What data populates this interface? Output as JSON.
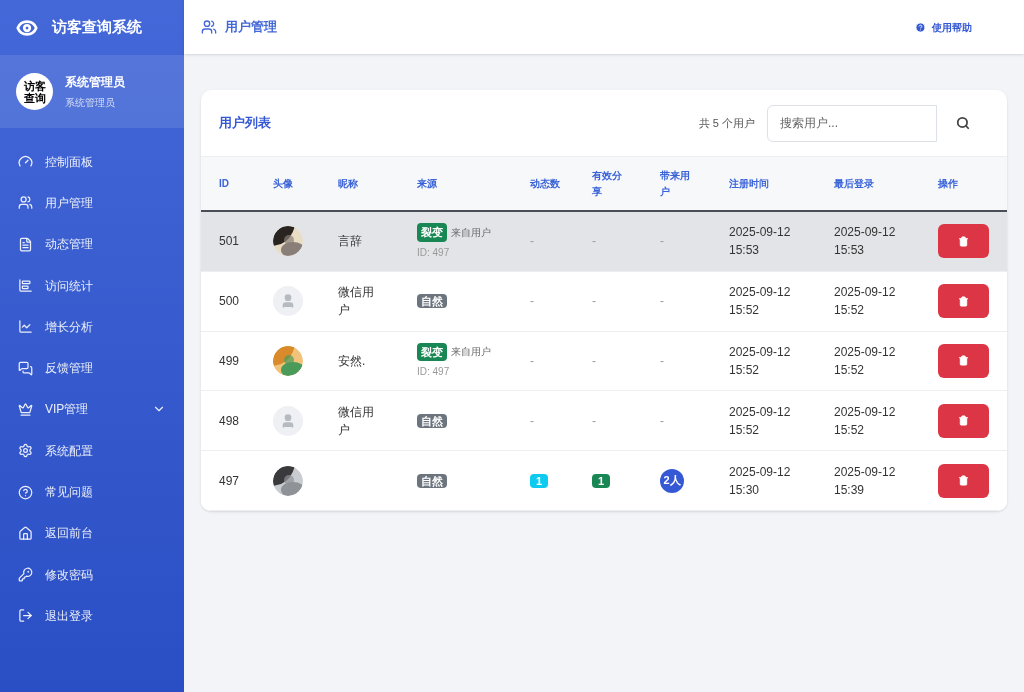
{
  "sidebar": {
    "title": "访客查询系统",
    "avatar_text": [
      "访客",
      "查询"
    ],
    "user_name": "系统管理员",
    "user_role": "系统管理员",
    "items": [
      {
        "kind": "dashboard",
        "label": "控制面板",
        "selected": false
      },
      {
        "kind": "users",
        "label": "用户管理",
        "selected": false
      },
      {
        "kind": "file",
        "label": "动态管理",
        "selected": false
      },
      {
        "kind": "stats",
        "label": "访问统计",
        "selected": false
      },
      {
        "kind": "growth",
        "label": "增长分析",
        "selected": false
      },
      {
        "kind": "chat",
        "label": "反馈管理",
        "selected": false
      },
      {
        "kind": "crown",
        "label": "VIP管理",
        "selected": false,
        "expandable": true
      },
      {
        "kind": "gear",
        "label": "系统配置",
        "selected": false
      },
      {
        "kind": "help",
        "label": "常见问题",
        "selected": false
      },
      {
        "kind": "home",
        "label": "返回前台",
        "selected": false
      },
      {
        "kind": "key",
        "label": "修改密码",
        "selected": false
      },
      {
        "kind": "logout",
        "label": "退出登录",
        "selected": false
      }
    ]
  },
  "header": {
    "title": "用户管理",
    "help": "使用帮助"
  },
  "card": {
    "title": "用户列表",
    "count": "共 5 个用户",
    "search": {
      "placeholder": "搜索用户..."
    }
  },
  "table": {
    "columns": [
      "ID",
      "头像",
      "昵称",
      "来源",
      "动态数",
      "有效分享",
      "带来用户",
      "注册时间",
      "最后登录",
      "操作"
    ],
    "rows": [
      {
        "selected": true,
        "id": "501",
        "nickname": "言辞",
        "source": {
          "kind": "fission",
          "badge": "裂变",
          "from": "来自用户",
          "ref": "ID: 497"
        },
        "posts": {
          "kind": "dash",
          "text": "-"
        },
        "shares": {
          "kind": "dash",
          "text": "-"
        },
        "invited": {
          "kind": "dash",
          "text": "-"
        },
        "registered": "2025-09-12 15:53",
        "last_login": "2025-09-12 15:53"
      },
      {
        "selected": false,
        "id": "500",
        "avatar": {
          "kind": "placeholder"
        },
        "nickname": "微信用户",
        "source": {
          "kind": "natural",
          "badge": "自然"
        },
        "posts": {
          "kind": "dash",
          "text": "-"
        },
        "shares": {
          "kind": "dash",
          "text": "-"
        },
        "invited": {
          "kind": "dash",
          "text": "-"
        },
        "registered": "2025-09-12 15:52",
        "last_login": "2025-09-12 15:52"
      },
      {
        "selected": false,
        "id": "499",
        "nickname": "安然.",
        "source": {
          "kind": "fission",
          "badge": "裂变",
          "from": "来自用户",
          "ref": "ID: 497"
        },
        "posts": {
          "kind": "dash",
          "text": "-"
        },
        "shares": {
          "kind": "dash",
          "text": "-"
        },
        "invited": {
          "kind": "dash",
          "text": "-"
        },
        "registered": "2025-09-12 15:52",
        "last_login": "2025-09-12 15:52"
      },
      {
        "selected": false,
        "id": "498",
        "avatar": {
          "kind": "placeholder"
        },
        "nickname": "微信用户",
        "source": {
          "kind": "natural",
          "badge": "自然"
        },
        "posts": {
          "kind": "dash",
          "text": "-"
        },
        "shares": {
          "kind": "dash",
          "text": "-"
        },
        "invited": {
          "kind": "dash",
          "text": "-"
        },
        "registered": "2025-09-12 15:52",
        "last_login": "2025-09-12 15:52"
      },
      {
        "selected": false,
        "id": "497",
        "source": {
          "kind": "natural",
          "badge": "自然"
        },
        "posts": {
          "kind": "badge",
          "text": "1",
          "color": "#0dcaf0"
        },
        "shares": {
          "kind": "badge",
          "text": "1",
          "color": "#198754"
        },
        "invited": {
          "kind": "pill",
          "text": "2人",
          "color": "#3558d4"
        },
        "registered": "2025-09-12 15:30",
        "last_login": "2025-09-12 15:39"
      }
    ]
  }
}
